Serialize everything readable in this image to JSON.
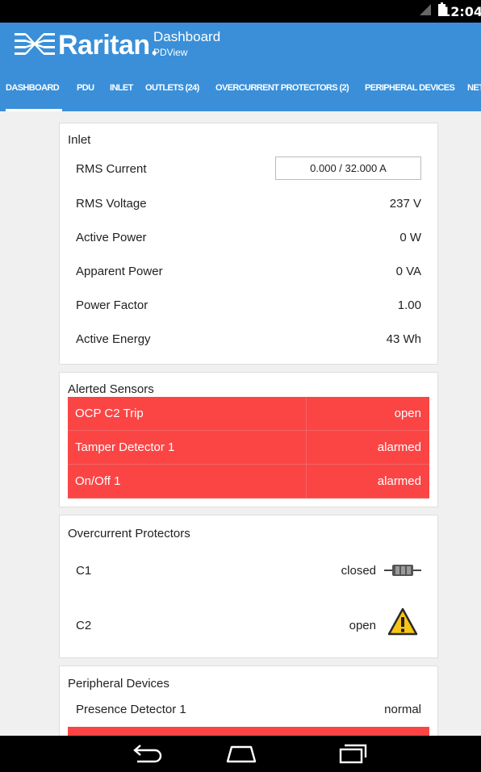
{
  "status_bar": {
    "time": "12:04"
  },
  "app_bar": {
    "brand": "Raritan",
    "title": "Dashboard",
    "subtitle": "PDView"
  },
  "tabs": [
    {
      "label": "DASHBOARD",
      "active": true
    },
    {
      "label": "PDU"
    },
    {
      "label": "INLET"
    },
    {
      "label": "OUTLETS (24)"
    },
    {
      "label": "OVERCURRENT PROTECTORS (2)"
    },
    {
      "label": "PERIPHERAL DEVICES"
    },
    {
      "label": "NET"
    }
  ],
  "inlet": {
    "title": "Inlet",
    "rows": [
      {
        "label": "RMS Current",
        "value": "0.000 / 32.000 A"
      },
      {
        "label": "RMS Voltage",
        "value": "237 V"
      },
      {
        "label": "Active Power",
        "value": "0 W"
      },
      {
        "label": "Apparent Power",
        "value": "0 VA"
      },
      {
        "label": "Power Factor",
        "value": "1.00"
      },
      {
        "label": "Active Energy",
        "value": "43 Wh"
      }
    ]
  },
  "alerted_sensors": {
    "title": "Alerted Sensors",
    "rows": [
      {
        "label": "OCP C2 Trip",
        "value": "open"
      },
      {
        "label": "Tamper Detector 1",
        "value": "alarmed"
      },
      {
        "label": "On/Off 1",
        "value": "alarmed"
      }
    ],
    "color": "#fb4545"
  },
  "overcurrent_protectors": {
    "title": "Overcurrent Protectors",
    "rows": [
      {
        "label": "C1",
        "value": "closed",
        "icon": "fuse-icon"
      },
      {
        "label": "C2",
        "value": "open",
        "icon": "warning-icon"
      }
    ]
  },
  "peripheral_devices": {
    "title": "Peripheral Devices",
    "rows": [
      {
        "label": "Presence Detector 1",
        "value": "normal"
      }
    ]
  },
  "colors": {
    "accent": "#3a8fd8",
    "alert": "#fb4545",
    "warning": "#f5c518"
  },
  "nav": {
    "back": "back-icon",
    "home": "home-icon",
    "recents": "recents-icon"
  }
}
